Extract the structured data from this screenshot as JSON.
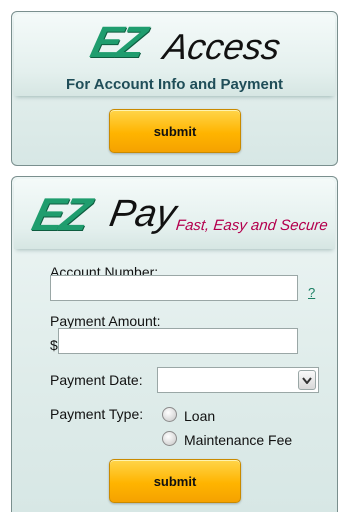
{
  "ezaccess": {
    "logo_ez": "EZ",
    "logo_word": "Access",
    "tagline": "For Account Info and Payment",
    "submit_label": "submit"
  },
  "ezpay": {
    "logo_ez": "EZ",
    "logo_word": "Pay",
    "tagline": "Fast, Easy and Secure",
    "account_number_label": "Account Number:",
    "account_number_value": "",
    "help_link": "?",
    "payment_amount_label": "Payment Amount:",
    "currency_symbol": "$",
    "payment_amount_value": "",
    "payment_date_label": "Payment Date:",
    "payment_date_value": "",
    "payment_type_label": "Payment Type:",
    "payment_type_options": [
      "Loan",
      "Maintenance Fee"
    ],
    "submit_label": "submit"
  },
  "colors": {
    "brand_green": "#1f9d6e",
    "tagline_magenta": "#b4004e",
    "tagline_teal": "#1f4d58",
    "button_yellow": "#ffc21a"
  }
}
